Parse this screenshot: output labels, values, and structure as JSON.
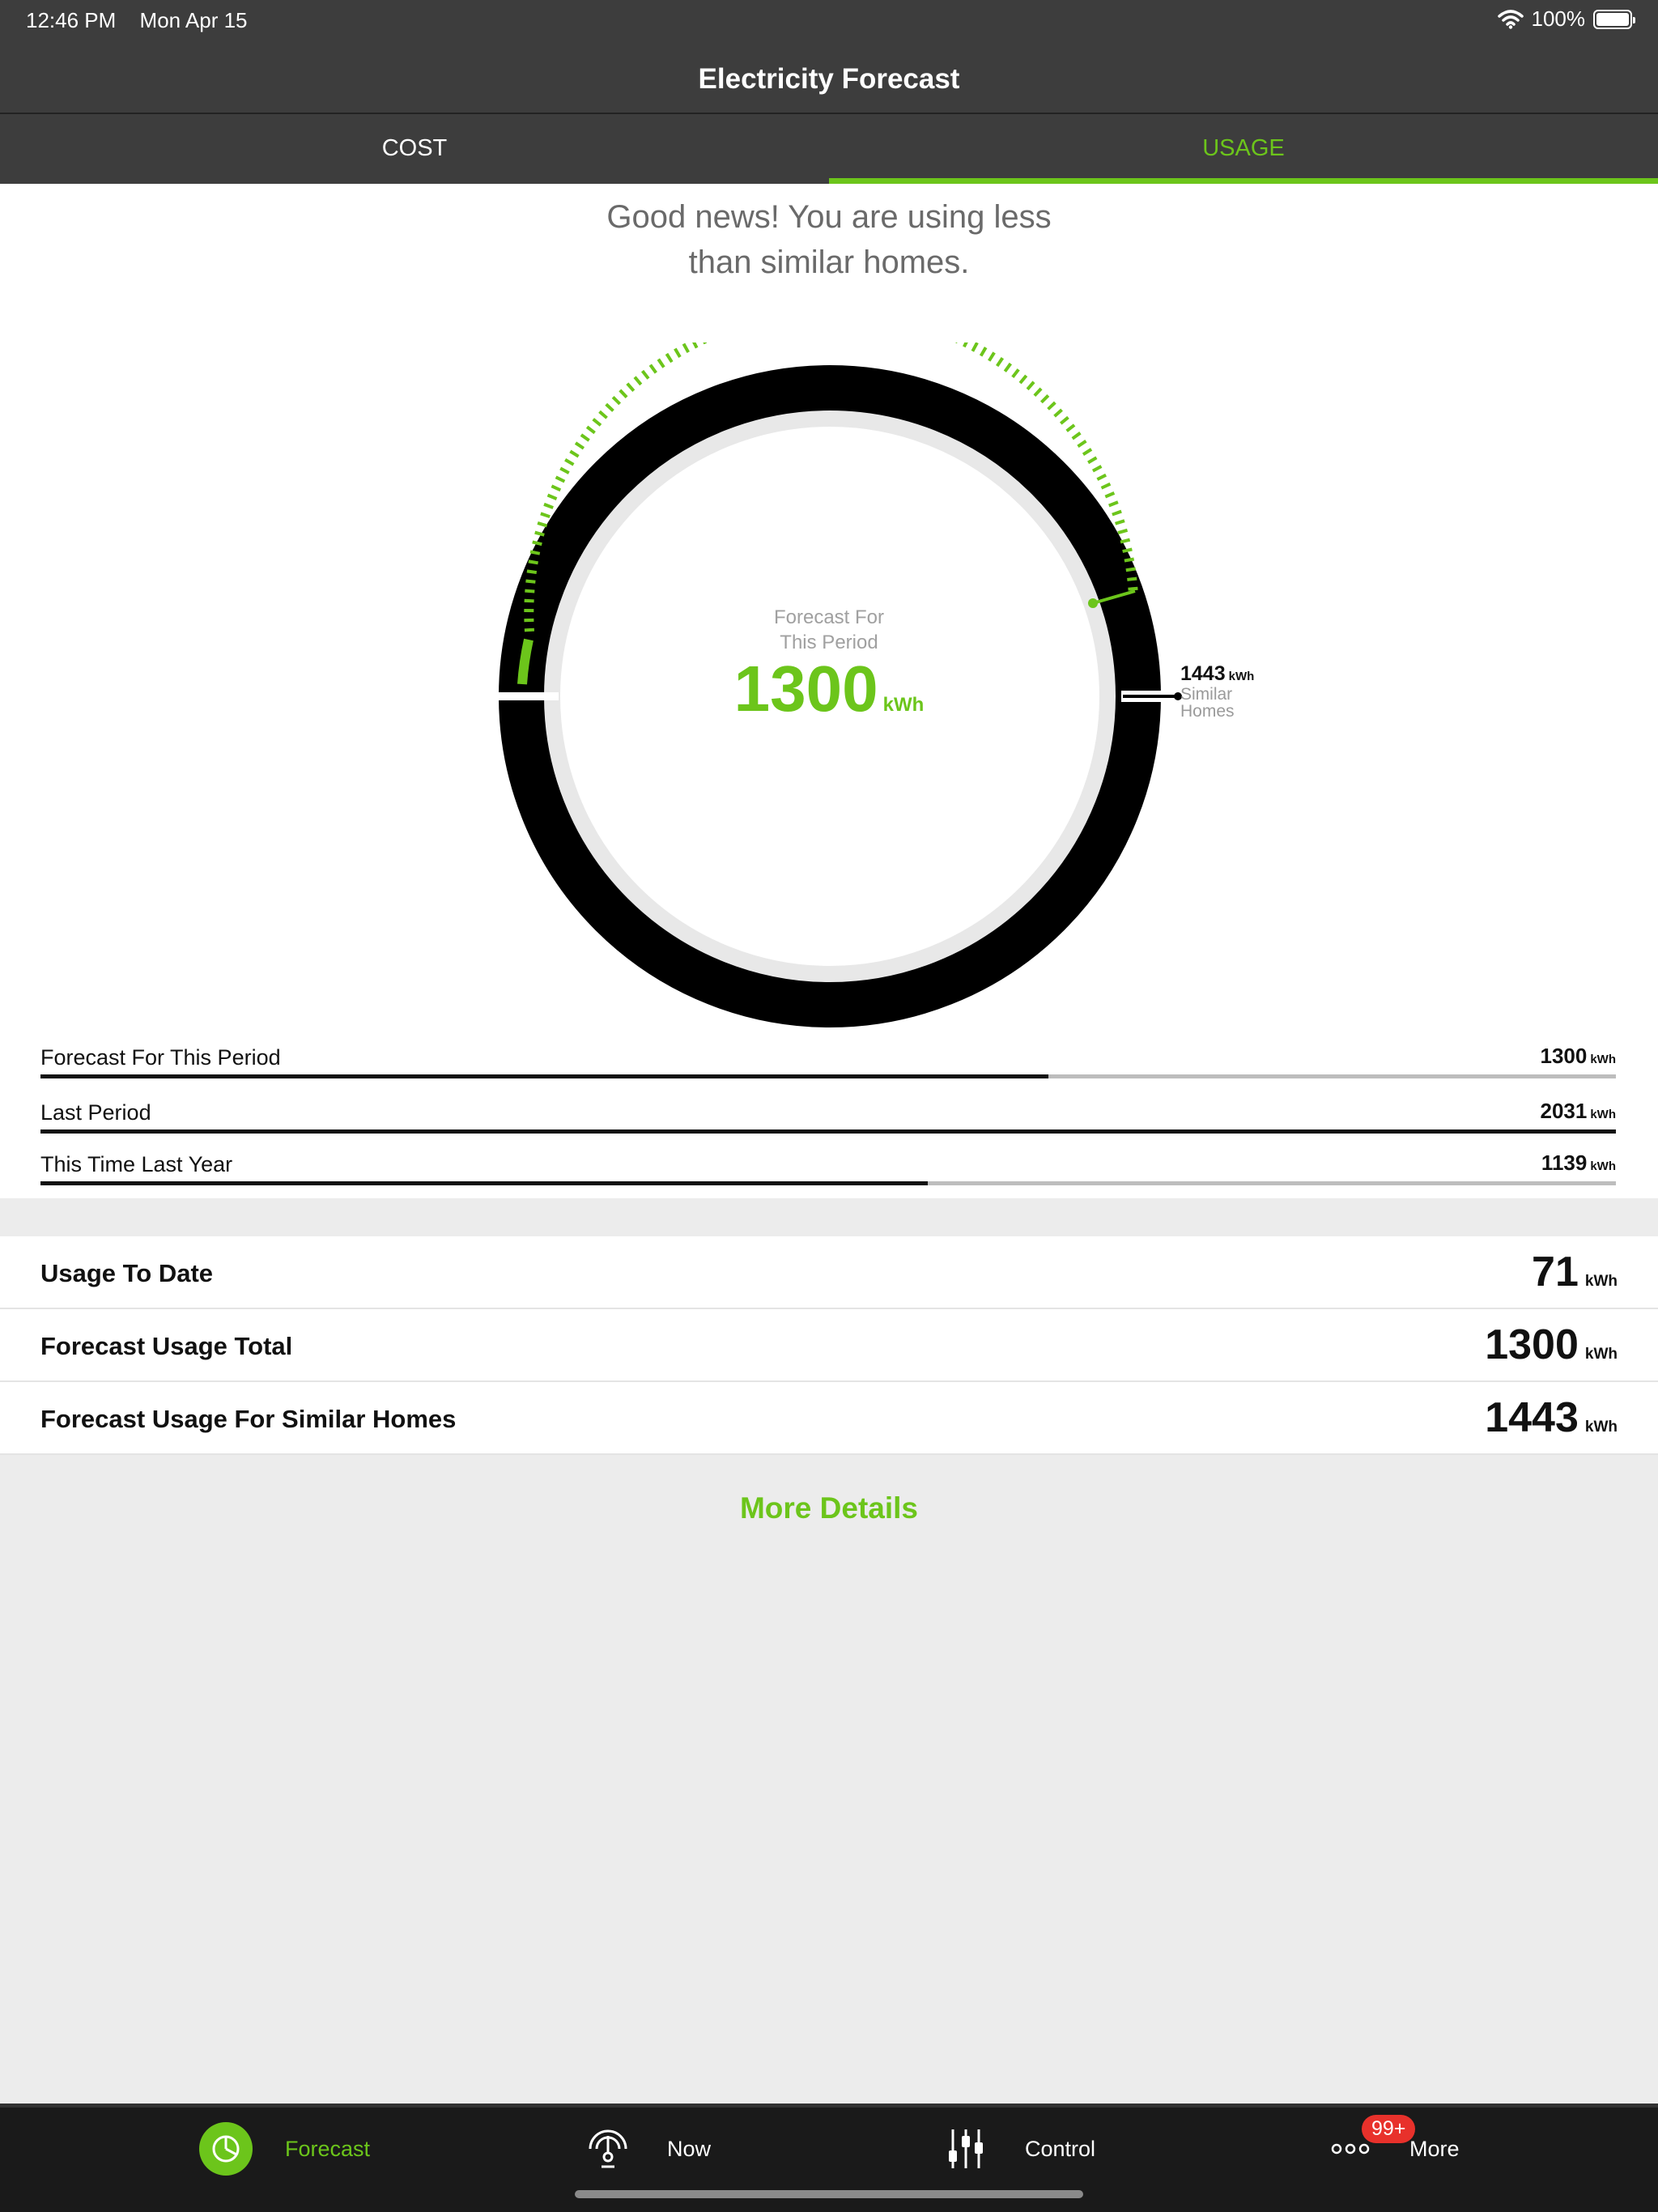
{
  "status": {
    "time": "12:46 PM",
    "date": "Mon Apr 15",
    "battery": "100%"
  },
  "header": {
    "title": "Electricity Forecast"
  },
  "tabs": [
    {
      "label": "COST"
    },
    {
      "label": "USAGE"
    }
  ],
  "headline": {
    "line1": "Good news! You are using less",
    "line2": "than similar homes."
  },
  "gauge": {
    "label_line1": "Forecast For",
    "label_line2": "This Period",
    "value": "1300",
    "unit": "kWh",
    "similar_value": "1443",
    "similar_unit": "kWh",
    "similar_line1": "Similar",
    "similar_line2": "Homes"
  },
  "comparisons": [
    {
      "label": "Forecast For This Period",
      "value": "1300",
      "unit": "kWh",
      "fraction": 0.64
    },
    {
      "label": "Last Period",
      "value": "2031",
      "unit": "kWh",
      "fraction": 1.0
    },
    {
      "label": "This Time Last Year",
      "value": "1139",
      "unit": "kWh",
      "fraction": 0.563
    }
  ],
  "summary": [
    {
      "label": "Usage To Date",
      "value": "71",
      "unit": "kWh"
    },
    {
      "label": "Forecast Usage Total",
      "value": "1300",
      "unit": "kWh"
    },
    {
      "label": "Forecast Usage For Similar Homes",
      "value": "1443",
      "unit": "kWh"
    }
  ],
  "more_details": "More Details",
  "nav": {
    "items": [
      {
        "label": "Forecast",
        "icon": "forecast-pie-icon"
      },
      {
        "label": "Now",
        "icon": "gauge-icon"
      },
      {
        "label": "Control",
        "icon": "sliders-icon"
      },
      {
        "label": "More",
        "icon": "more-dots-icon"
      }
    ],
    "badge": "99+"
  },
  "colors": {
    "accent": "#6cc51b",
    "header": "#3d3d3d",
    "badge": "#e8312b"
  }
}
